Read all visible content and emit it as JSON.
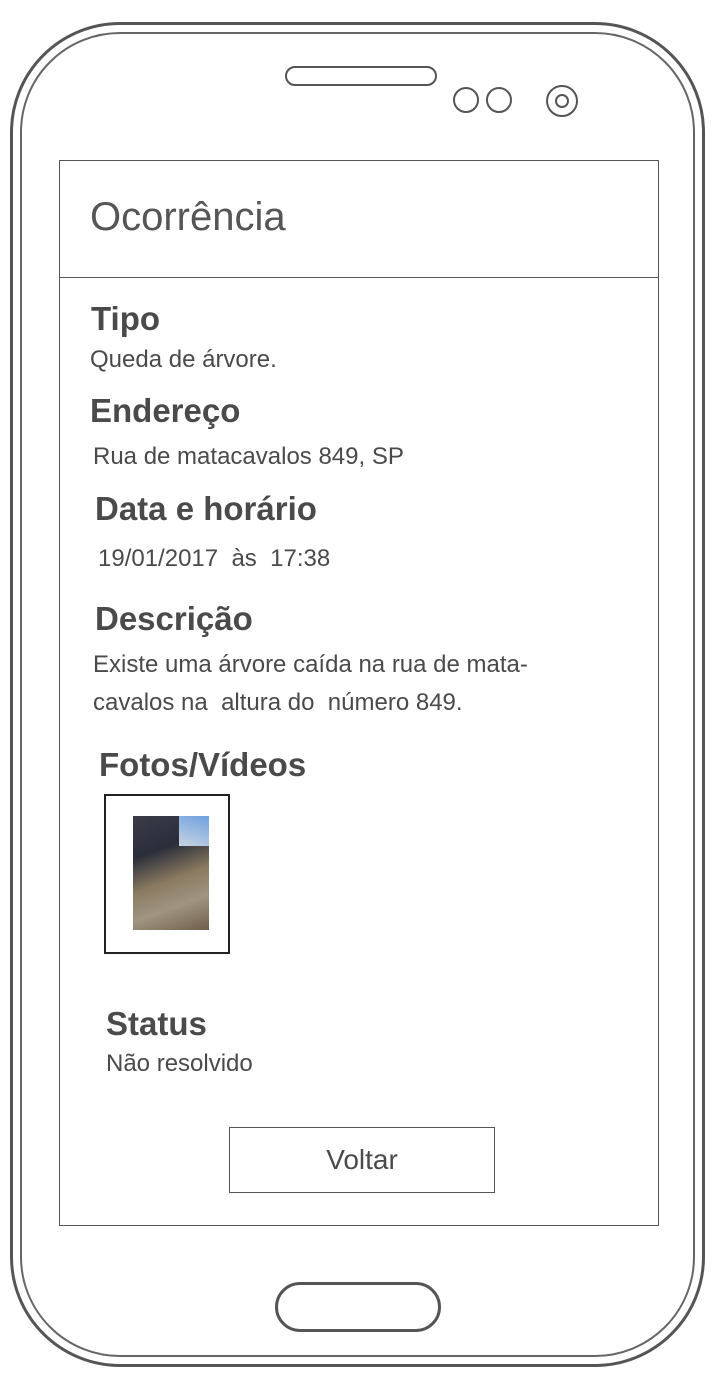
{
  "header": {
    "title": "Ocorrência"
  },
  "fields": {
    "tipo": {
      "label": "Tipo",
      "value": "Queda de árvore."
    },
    "endereco": {
      "label": "Endereço",
      "value": "Rua de matacavalos 849, SP"
    },
    "data": {
      "label": "Data e horário",
      "value": "19/01/2017  às  17:38"
    },
    "descricao": {
      "label": "Descrição",
      "line1": "Existe uma árvore caída na rua de mata-",
      "line2": "cavalos na  altura do  número 849."
    },
    "fotos": {
      "label": "Fotos/Vídeos",
      "thumbnail": "fallen-tree-photo"
    },
    "status": {
      "label": "Status",
      "value": "Não resolvido"
    }
  },
  "actions": {
    "back_label": "Voltar"
  }
}
